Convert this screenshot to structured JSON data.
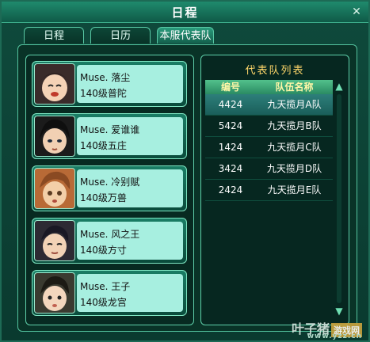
{
  "window": {
    "title": "日程"
  },
  "tabs": [
    {
      "label": "日程"
    },
    {
      "label": "日历"
    },
    {
      "label": "本服代表队",
      "active": true
    }
  ],
  "members": [
    {
      "name": "Muse. 落尘",
      "desc": "140级普陀"
    },
    {
      "name": "Muse. 爱谁谁",
      "desc": "140级五庄"
    },
    {
      "name": "Muse. 冷别赋",
      "desc": "140级万兽"
    },
    {
      "name": "Muse. 风之王",
      "desc": "140级方寸"
    },
    {
      "name": "Muse. 王子",
      "desc": "140级龙宫"
    }
  ],
  "team_list": {
    "title": "代表队列表",
    "headers": {
      "id": "编号",
      "name": "队伍名称"
    },
    "rows": [
      {
        "id": "4424",
        "name": "九天揽月A队",
        "selected": true
      },
      {
        "id": "5424",
        "name": "九天揽月B队"
      },
      {
        "id": "1424",
        "name": "九天揽月C队"
      },
      {
        "id": "3424",
        "name": "九天揽月D队"
      },
      {
        "id": "2424",
        "name": "九天揽月E队"
      }
    ]
  },
  "icons": {
    "close": "close-icon",
    "scroll_up": "scroll-up-icon",
    "scroll_down": "scroll-down-icon"
  },
  "watermark": {
    "text": "叶子猪",
    "badge": "游戏网",
    "sub": "www.yzz.cn"
  }
}
